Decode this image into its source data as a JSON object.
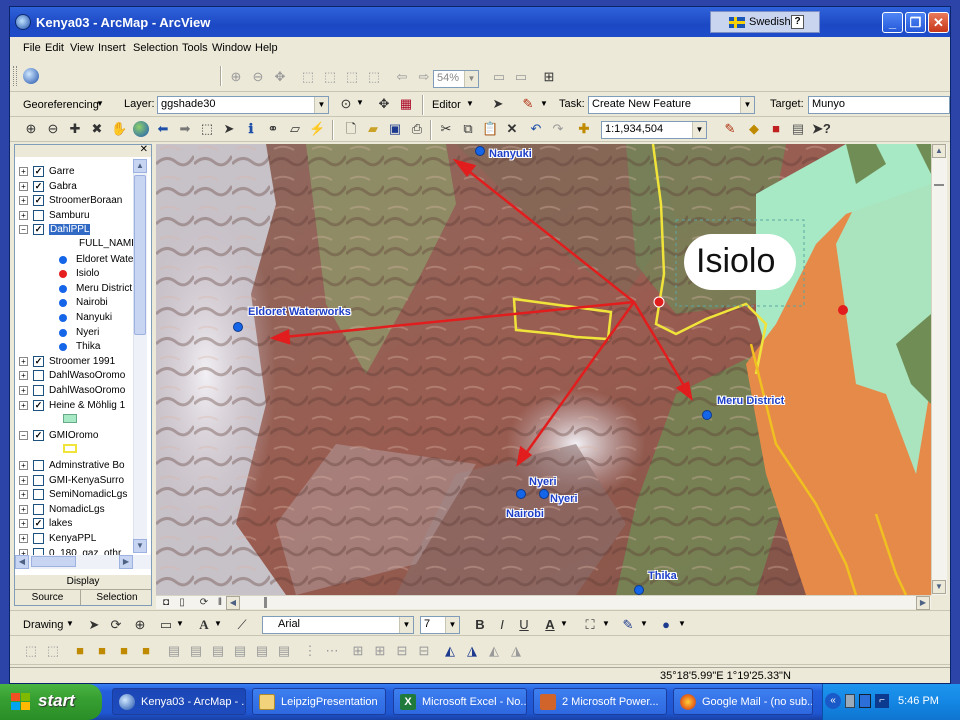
{
  "window": {
    "title": "Kenya03 - ArcMap - ArcView",
    "language": "Swedish",
    "help": "?"
  },
  "menubar": [
    "File",
    "Edit",
    "View",
    "Insert",
    "Selection",
    "Tools",
    "Window",
    "Help"
  ],
  "toolbar_top": {
    "zoom_percent": "54%"
  },
  "toolbar_georef": {
    "georeferencing_label": "Georeferencing",
    "layer_label": "Layer:",
    "layer_value": "ggshade30",
    "editor_label": "Editor",
    "task_label": "Task:",
    "task_value": "Create New Feature",
    "target_label": "Target:",
    "target_value": "Munyo"
  },
  "toolbar_tools": {
    "scale_value": "1:1,934,504"
  },
  "toc": {
    "layers": [
      {
        "name": "Garre",
        "checked": true,
        "expanded": false
      },
      {
        "name": "Gabra",
        "checked": true,
        "expanded": false
      },
      {
        "name": "StroomerBoraan",
        "checked": true,
        "expanded": false
      },
      {
        "name": "Samburu",
        "checked": false,
        "expanded": false
      },
      {
        "name": "DahlPPL",
        "checked": true,
        "expanded": true,
        "selected": true
      }
    ],
    "dahlppl_field": "FULL_NAME",
    "dahlppl_legend": [
      {
        "name": "Eldoret Wate",
        "color": "#1565e8"
      },
      {
        "name": "Isiolo",
        "color": "#e61e1e"
      },
      {
        "name": "Meru District",
        "color": "#1565e8"
      },
      {
        "name": "Nairobi",
        "color": "#1565e8"
      },
      {
        "name": "Nanyuki",
        "color": "#1565e8"
      },
      {
        "name": "Nyeri",
        "color": "#1565e8"
      },
      {
        "name": "Thika",
        "color": "#1565e8"
      }
    ],
    "layers2": [
      {
        "name": "Stroomer 1991",
        "checked": true
      },
      {
        "name": "DahlWasoOromo",
        "checked": false
      },
      {
        "name": "DahlWasoOromo",
        "checked": false
      },
      {
        "name": "Heine & Möhlig 1",
        "checked": true
      }
    ],
    "layers3": [
      {
        "name": "GMIOromo",
        "checked": true
      }
    ],
    "layers4": [
      {
        "name": "Adminstrative Bo",
        "checked": false
      },
      {
        "name": "GMI-KenyaSurro",
        "checked": false
      },
      {
        "name": "SemiNomadicLgs",
        "checked": false
      },
      {
        "name": "NomadicLgs",
        "checked": false
      },
      {
        "name": "lakes",
        "checked": true
      },
      {
        "name": "KenyaPPL",
        "checked": false
      },
      {
        "name": "0_180_gaz_othr",
        "checked": false
      }
    ],
    "tabs": {
      "display": "Display",
      "source": "Source",
      "selection": "Selection"
    }
  },
  "map": {
    "callout": "Isiolo",
    "places": {
      "nanyuki": "Nanyuki",
      "eldoret": "Eldoret Waterworks",
      "meru": "Meru District",
      "nyeri1": "Nyeri",
      "nyeri2": "Nyeri",
      "nairobi": "Nairobi",
      "thika": "Thika"
    }
  },
  "drawing_toolbar": {
    "drawing_label": "Drawing",
    "font_value": "Arial",
    "size_value": "7",
    "bold": "B",
    "italic": "I",
    "underline": "U",
    "font_color": "A"
  },
  "status": {
    "coords": "35°18'5.99\"E  1°19'25.33\"N"
  },
  "taskbar": {
    "start": "start",
    "tasks": [
      "Kenya03 - ArcMap - ...",
      "LeipzigPresentation",
      "Microsoft Excel - No...",
      "2 Microsoft Power...",
      "Google Mail - (no sub..."
    ],
    "clock": "5:46 PM"
  }
}
